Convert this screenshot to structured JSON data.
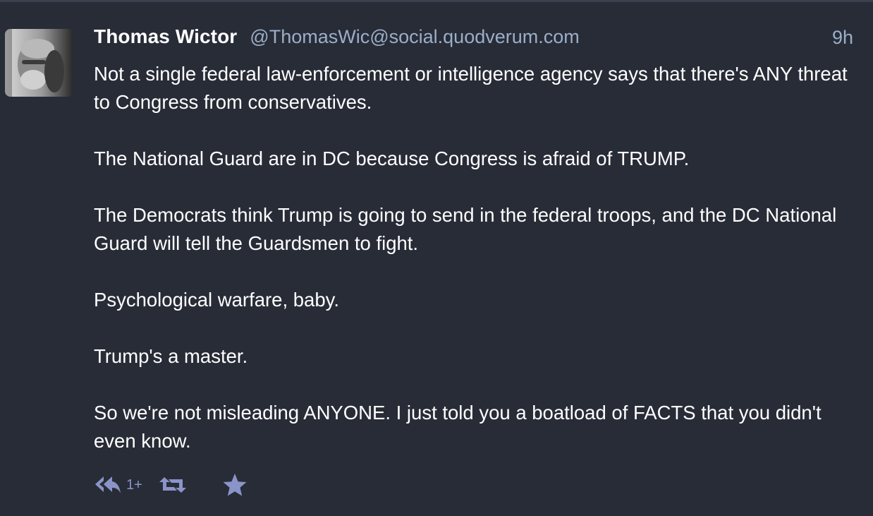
{
  "status": {
    "display_name": "Thomas Wictor",
    "acct": "@ThomasWic@social.quodverum.com",
    "relative_time": "9h",
    "paragraphs": [
      "Not a single federal law-enforcement or intelligence agency says that there's ANY threat to Congress from conservatives.",
      "The National Guard are in DC because Congress is afraid of TRUMP.",
      "The Democrats think Trump is going to send in the federal troops, and the DC National Guard will tell the Guardsmen to fight.",
      "Psychological warfare, baby.",
      "Trump's a master.",
      "So we're not misleading ANYONE. I just told you a boatload of FACTS that you didn't even know."
    ],
    "actions": {
      "reply_icon": "reply-all-icon",
      "reply_count": "1+",
      "boost_icon": "retweet-icon",
      "favourite_icon": "star-icon"
    }
  },
  "colors": {
    "background": "#282c37",
    "text": "#ffffff",
    "secondary": "#9baec8",
    "action": "#8b94c8"
  }
}
